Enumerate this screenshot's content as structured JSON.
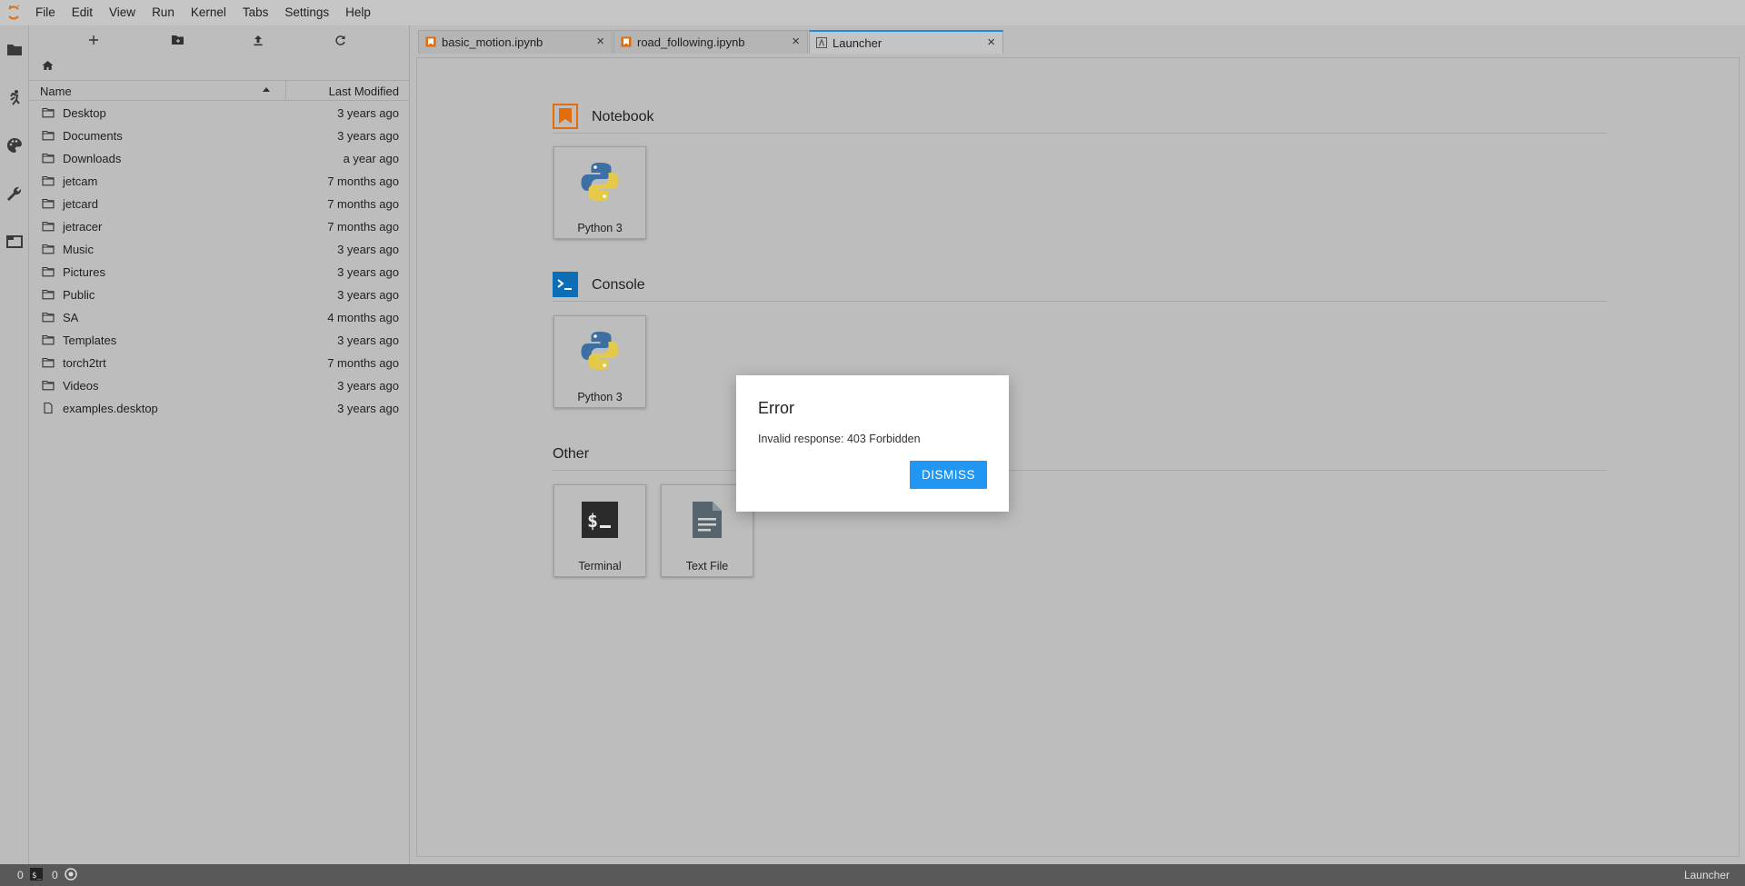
{
  "menubar": {
    "items": [
      "File",
      "Edit",
      "View",
      "Run",
      "Kernel",
      "Tabs",
      "Settings",
      "Help"
    ]
  },
  "activitybar": {
    "icons": [
      "folder-icon",
      "running-icon",
      "palette-icon",
      "wrench-icon",
      "tabs-icon"
    ]
  },
  "filebrowser": {
    "columns": {
      "name": "Name",
      "modified": "Last Modified"
    },
    "rows": [
      {
        "name": "Desktop",
        "modified": "3 years ago",
        "type": "folder"
      },
      {
        "name": "Documents",
        "modified": "3 years ago",
        "type": "folder"
      },
      {
        "name": "Downloads",
        "modified": "a year ago",
        "type": "folder"
      },
      {
        "name": "jetcam",
        "modified": "7 months ago",
        "type": "folder"
      },
      {
        "name": "jetcard",
        "modified": "7 months ago",
        "type": "folder"
      },
      {
        "name": "jetracer",
        "modified": "7 months ago",
        "type": "folder"
      },
      {
        "name": "Music",
        "modified": "3 years ago",
        "type": "folder"
      },
      {
        "name": "Pictures",
        "modified": "3 years ago",
        "type": "folder"
      },
      {
        "name": "Public",
        "modified": "3 years ago",
        "type": "folder"
      },
      {
        "name": "SA",
        "modified": "4 months ago",
        "type": "folder"
      },
      {
        "name": "Templates",
        "modified": "3 years ago",
        "type": "folder"
      },
      {
        "name": "torch2trt",
        "modified": "7 months ago",
        "type": "folder"
      },
      {
        "name": "Videos",
        "modified": "3 years ago",
        "type": "folder"
      },
      {
        "name": "examples.desktop",
        "modified": "3 years ago",
        "type": "file"
      }
    ]
  },
  "tabs": [
    {
      "label": "basic_motion.ipynb",
      "icon": "notebook-icon",
      "active": false
    },
    {
      "label": "road_following.ipynb",
      "icon": "notebook-icon",
      "active": false
    },
    {
      "label": "Launcher",
      "icon": "launcher-icon",
      "active": true
    }
  ],
  "launcher": {
    "notebook_title": "Notebook",
    "notebook_card": "Python 3",
    "console_title": "Console",
    "console_card": "Python 3",
    "other_title": "Other",
    "terminal_card": "Terminal",
    "textfile_card": "Text File"
  },
  "dialog": {
    "title": "Error",
    "body": "Invalid response: 403 Forbidden",
    "button": "DISMISS"
  },
  "statusbar": {
    "terminals": "0",
    "kernels": "0",
    "mode": "Launcher"
  },
  "colors": {
    "accent": "#2196f3",
    "notebook_orange": "#e46c0a",
    "console_blue": "#0b6eb7",
    "python_blue": "#3c6fa3",
    "python_yellow": "#e5c94b"
  }
}
